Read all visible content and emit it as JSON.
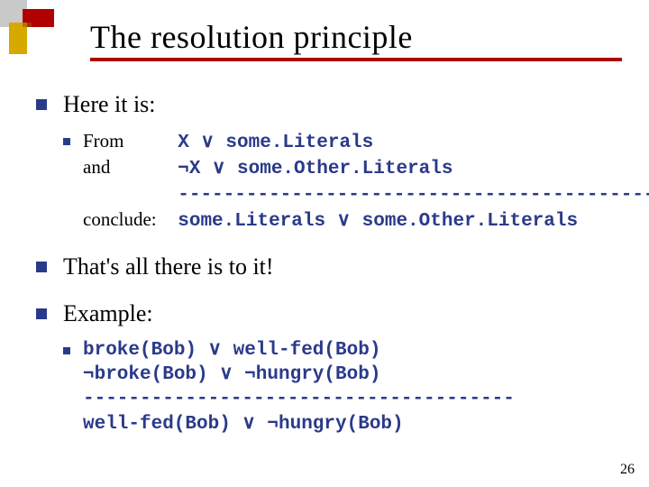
{
  "title": "The resolution principle",
  "page_number": "26",
  "bullets": {
    "here": "Here it is:",
    "thats_all": "That's all there is to it!",
    "example": "Example:"
  },
  "rule": {
    "from_label": "From",
    "and_label": "and",
    "conclude_label": "conclude:",
    "line1": " X  ∨  some.Literals",
    "line2": "¬X  ∨  some.Other.Literals",
    "sep": "----------------------------------------------",
    "line3": "some.Literals  ∨  some.Other.Literals"
  },
  "example_lines": {
    "l1": "broke(Bob) ∨ well-fed(Bob)",
    "l2": "¬broke(Bob) ∨ ¬hungry(Bob)",
    "sep": "--------------------------------------",
    "l3": "well-fed(Bob) ∨ ¬hungry(Bob)"
  }
}
